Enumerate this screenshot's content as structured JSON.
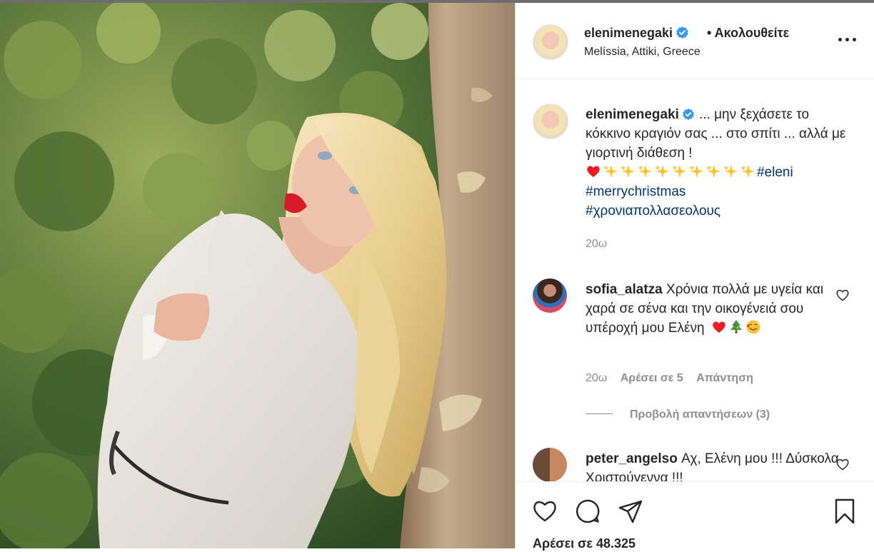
{
  "post": {
    "username": "elenimenegaki",
    "follow_status": "• Ακολουθείτε",
    "location": "Melíssia, Attiki, Greece"
  },
  "caption": {
    "username": "elenimenegaki",
    "text": "... μην ξεχάσετε το κόκκινο κραγιόν σας ... στο σπίτι ... αλλά με γιορτινή διάθεση !",
    "hashtags": [
      "#eleni",
      "#merrychristmas",
      "#χρονιαπολλασεολους"
    ],
    "time": "20ω"
  },
  "comments": [
    {
      "username": "sofia_alatza",
      "text": "Χρόνια πολλά με υγεία και χαρά σε σένα και την οικογένειά σου υπέροχή μου Ελένη",
      "time": "20ω",
      "likes": "Αρέσει σε 5",
      "reply": "Απάντηση",
      "view_replies": "Προβολή απαντήσεων (3)"
    },
    {
      "username": "peter_angelso",
      "text": "Αχ, Ελένη μου !!! Δύσκολα Χριστούγεννα !!!"
    }
  ],
  "actions": {
    "likes": "Αρέσει σε 48.325"
  },
  "icons": [
    "verified-badge-icon",
    "more-options-icon",
    "heart-icon",
    "comment-icon",
    "share-icon",
    "bookmark-icon",
    "sparkles-icon",
    "christmas-tree-icon",
    "smiling-face-icon"
  ],
  "colors": {
    "hashtag": "#00376b",
    "verified": "#3897f0",
    "red_heart": "#ed1c24"
  }
}
